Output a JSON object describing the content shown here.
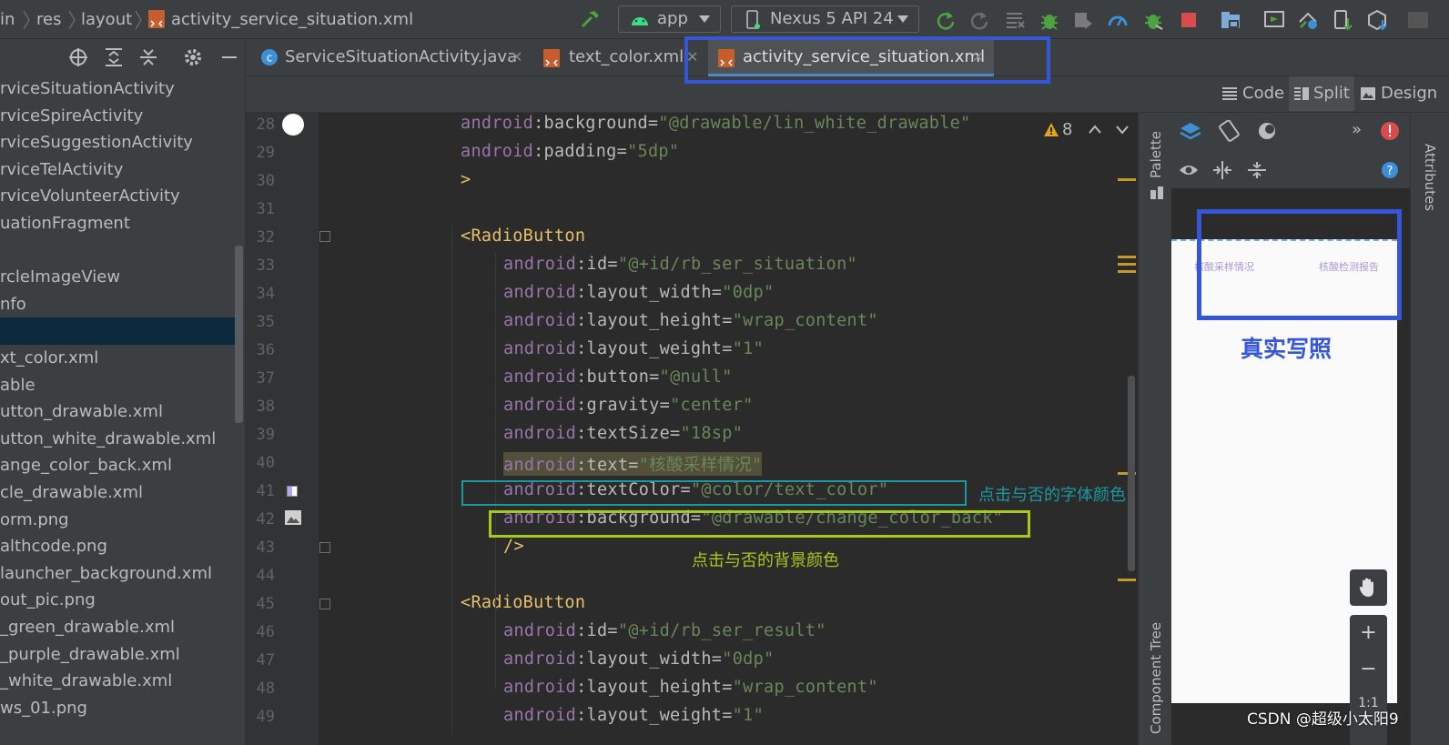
{
  "breadcrumb": {
    "items": [
      "in",
      "res",
      "layout",
      "activity_service_situation.xml"
    ]
  },
  "toolbar": {
    "app_config": "app",
    "device": "Nexus 5 API 24"
  },
  "project_tree": {
    "items": [
      "rviceSituationActivity",
      "rviceSpireActivity",
      "rviceSuggestionActivity",
      "rviceTelActivity",
      "rviceVolunteerActivity",
      "uationFragment",
      "",
      "rcleImageView",
      "nfo",
      "",
      "xt_color.xml",
      "able",
      "utton_drawable.xml",
      "utton_white_drawable.xml",
      "ange_color_back.xml",
      "cle_drawable.xml",
      "orm.png",
      "althcode.png",
      "launcher_background.xml",
      "out_pic.png",
      "_green_drawable.xml",
      "_purple_drawable.xml",
      "_white_drawable.xml",
      "ws_01.png"
    ]
  },
  "tabs": [
    {
      "label": "ServiceSituationActivity.java",
      "icon": "java-class-icon"
    },
    {
      "label": "text_color.xml",
      "icon": "xml-file-icon"
    },
    {
      "label": "activity_service_situation.xml",
      "icon": "xml-file-icon",
      "active": true
    }
  ],
  "modes": {
    "code": "Code",
    "split": "Split",
    "design": "Design"
  },
  "editor": {
    "warnings_count": "8",
    "lines": [
      {
        "n": "28",
        "indent": 2,
        "parts": [
          [
            "ns",
            "android"
          ],
          [
            "eq",
            ":"
          ],
          [
            "name",
            "background"
          ],
          [
            "eq",
            "="
          ],
          [
            "str",
            "\"@drawable/lin_white_drawable\""
          ]
        ]
      },
      {
        "n": "29",
        "indent": 2,
        "parts": [
          [
            "ns",
            "android"
          ],
          [
            "eq",
            ":"
          ],
          [
            "name",
            "padding"
          ],
          [
            "eq",
            "="
          ],
          [
            "str",
            "\"5dp\""
          ]
        ]
      },
      {
        "n": "30",
        "indent": 2,
        "parts": [
          [
            "tag",
            ">"
          ]
        ]
      },
      {
        "n": "31",
        "indent": 0,
        "parts": []
      },
      {
        "n": "32",
        "indent": 2,
        "parts": [
          [
            "tag",
            "<RadioButton"
          ]
        ]
      },
      {
        "n": "33",
        "indent": 3,
        "parts": [
          [
            "ns",
            "android"
          ],
          [
            "eq",
            ":"
          ],
          [
            "name",
            "id"
          ],
          [
            "eq",
            "="
          ],
          [
            "str",
            "\"@+id/rb_ser_situation\""
          ]
        ]
      },
      {
        "n": "34",
        "indent": 3,
        "parts": [
          [
            "ns",
            "android"
          ],
          [
            "eq",
            ":"
          ],
          [
            "name",
            "layout_width"
          ],
          [
            "eq",
            "="
          ],
          [
            "str",
            "\"0dp\""
          ]
        ]
      },
      {
        "n": "35",
        "indent": 3,
        "parts": [
          [
            "ns",
            "android"
          ],
          [
            "eq",
            ":"
          ],
          [
            "name",
            "layout_height"
          ],
          [
            "eq",
            "="
          ],
          [
            "str",
            "\"wrap_content\""
          ]
        ]
      },
      {
        "n": "36",
        "indent": 3,
        "parts": [
          [
            "ns",
            "android"
          ],
          [
            "eq",
            ":"
          ],
          [
            "name",
            "layout_weight"
          ],
          [
            "eq",
            "="
          ],
          [
            "str",
            "\"1\""
          ]
        ]
      },
      {
        "n": "37",
        "indent": 3,
        "parts": [
          [
            "ns",
            "android"
          ],
          [
            "eq",
            ":"
          ],
          [
            "name",
            "button"
          ],
          [
            "eq",
            "="
          ],
          [
            "str",
            "\"@null\""
          ]
        ]
      },
      {
        "n": "38",
        "indent": 3,
        "parts": [
          [
            "ns",
            "android"
          ],
          [
            "eq",
            ":"
          ],
          [
            "name",
            "gravity"
          ],
          [
            "eq",
            "="
          ],
          [
            "str",
            "\"center\""
          ]
        ]
      },
      {
        "n": "39",
        "indent": 3,
        "parts": [
          [
            "ns",
            "android"
          ],
          [
            "eq",
            ":"
          ],
          [
            "name",
            "textSize"
          ],
          [
            "eq",
            "="
          ],
          [
            "str",
            "\"18sp\""
          ]
        ]
      },
      {
        "n": "40",
        "indent": 3,
        "highlight": true,
        "parts": [
          [
            "ns",
            "android"
          ],
          [
            "eq",
            ":"
          ],
          [
            "name",
            "text"
          ],
          [
            "eq",
            "="
          ],
          [
            "str",
            "\"核酸采样情况\""
          ]
        ]
      },
      {
        "n": "41",
        "indent": 3,
        "parts": [
          [
            "ns",
            "android"
          ],
          [
            "eq",
            ":"
          ],
          [
            "name",
            "textColor"
          ],
          [
            "eq",
            "="
          ],
          [
            "str",
            "\"@color/text_color\""
          ]
        ]
      },
      {
        "n": "42",
        "indent": 3,
        "parts": [
          [
            "ns",
            "android"
          ],
          [
            "eq",
            ":"
          ],
          [
            "name",
            "background"
          ],
          [
            "eq",
            "="
          ],
          [
            "str",
            "\"@drawable/change_color_back\""
          ]
        ]
      },
      {
        "n": "43",
        "indent": 3,
        "parts": [
          [
            "tag",
            "/>"
          ]
        ]
      },
      {
        "n": "44",
        "indent": 0,
        "parts": []
      },
      {
        "n": "45",
        "indent": 2,
        "parts": [
          [
            "tag",
            "<RadioButton"
          ]
        ]
      },
      {
        "n": "46",
        "indent": 3,
        "parts": [
          [
            "ns",
            "android"
          ],
          [
            "eq",
            ":"
          ],
          [
            "name",
            "id"
          ],
          [
            "eq",
            "="
          ],
          [
            "str",
            "\"@+id/rb_ser_result\""
          ]
        ]
      },
      {
        "n": "47",
        "indent": 3,
        "parts": [
          [
            "ns",
            "android"
          ],
          [
            "eq",
            ":"
          ],
          [
            "name",
            "layout_width"
          ],
          [
            "eq",
            "="
          ],
          [
            "str",
            "\"0dp\""
          ]
        ]
      },
      {
        "n": "48",
        "indent": 3,
        "parts": [
          [
            "ns",
            "android"
          ],
          [
            "eq",
            ":"
          ],
          [
            "name",
            "layout_height"
          ],
          [
            "eq",
            "="
          ],
          [
            "str",
            "\"wrap_content\""
          ]
        ]
      },
      {
        "n": "49",
        "indent": 3,
        "parts": [
          [
            "ns",
            "android"
          ],
          [
            "eq",
            ":"
          ],
          [
            "name",
            "layout_weight"
          ],
          [
            "eq",
            "="
          ],
          [
            "str",
            "\"1\""
          ]
        ]
      }
    ]
  },
  "annotations": {
    "text_color_note": "点击与否的字体颜色",
    "background_note": "点击与否的背景颜色",
    "preview_caption": "真实写照",
    "text_color_box_color": "#1a9aa0",
    "background_box_color": "#a8c81a",
    "tab_box_color": "#3556d6"
  },
  "side_panels": {
    "palette": "Palette",
    "component_tree": "Component Tree",
    "attributes": "Attributes"
  },
  "preview": {
    "tab_left": "核酸采样情况",
    "tab_right": "核酸检测报告"
  },
  "zoom": {
    "plus": "+",
    "minus": "−",
    "one_to_one": "1:1"
  },
  "watermark": "CSDN @超级小太阳9"
}
